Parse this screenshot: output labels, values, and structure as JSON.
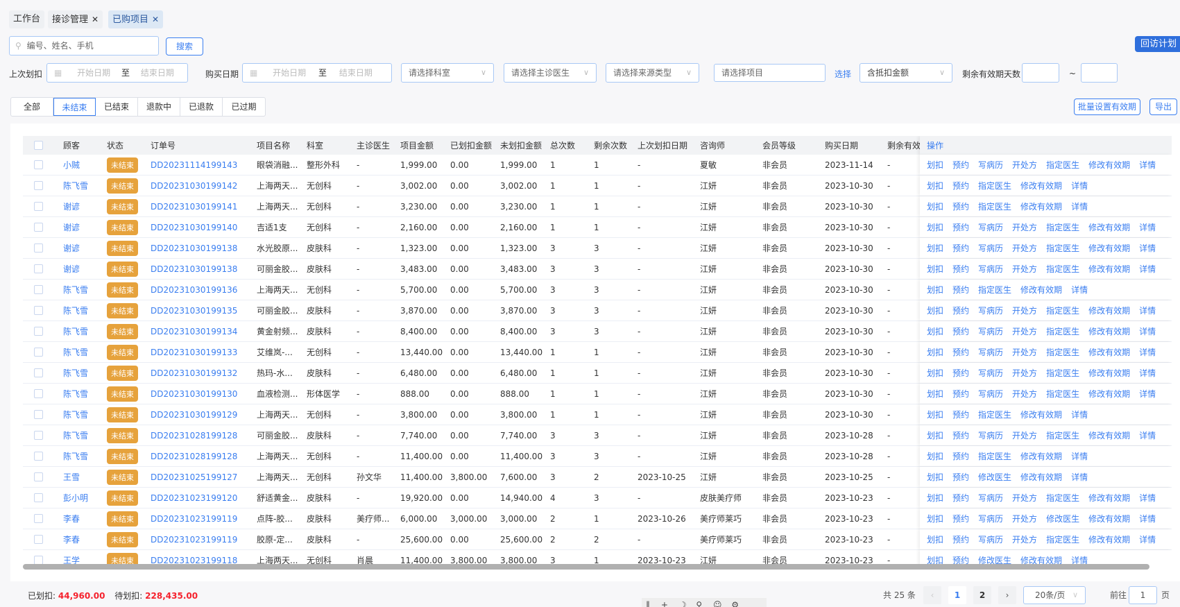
{
  "tabs": [
    {
      "label": "工作台"
    },
    {
      "label": "接诊管理",
      "close": "✕"
    },
    {
      "label": "已购项目",
      "close": "✕"
    }
  ],
  "search": {
    "placeholder": "编号、姓名、手机",
    "button": "搜索"
  },
  "followup_button": "回访计划",
  "filters": {
    "last_deduct_label": "上次划扣",
    "start_placeholder": "开始日期",
    "to": "至",
    "end_placeholder": "结束日期",
    "purchase_label": "购买日期",
    "department_placeholder": "请选择科室",
    "doctor_placeholder": "请选择主诊医生",
    "source_placeholder": "请选择来源类型",
    "item_placeholder": "请选择项目",
    "select_link": "选择",
    "amount_select": "含抵扣金额",
    "days_label": "剩余有效期天数",
    "tilde": "~"
  },
  "status_tabs": [
    "全部",
    "未结束",
    "已结束",
    "退款中",
    "已退款",
    "已过期"
  ],
  "active_status": 1,
  "batch_button": "批量设置有效期",
  "export_button": "导出",
  "columns": [
    "",
    "顾客",
    "状态",
    "订单号",
    "项目名称",
    "科室",
    "主诊医生",
    "项目金额",
    "已划扣金额",
    "未划扣金额",
    "总次数",
    "剩余次数",
    "上次划扣日期",
    "咨询师",
    "会员等级",
    "购买日期",
    "剩余有效期",
    "操作"
  ],
  "ops": {
    "A": [
      "划扣",
      "预约",
      "写病历",
      "开处方",
      "指定医生",
      "修改有效期",
      "详情"
    ],
    "B": [
      "划扣",
      "预约",
      "指定医生",
      "修改有效期",
      "详情"
    ],
    "C": [
      "划扣",
      "预约",
      "修改医生",
      "修改有效期",
      "详情"
    ],
    "D": [
      "划扣",
      "预约",
      "写病历",
      "开处方",
      "修改医生",
      "修改有效期",
      "详情"
    ]
  },
  "rows": [
    {
      "customer": "小贼",
      "status": "未结束",
      "order": "DD20231114199143",
      "item": "眼袋消融...",
      "dept": "整形外科",
      "doctor": "-",
      "amount": "1,999.00",
      "deducted": "0.00",
      "remaining_amt": "1,999.00",
      "total": "1",
      "left": "1",
      "last": "-",
      "consultant": "夏敏",
      "level": "非会员",
      "date": "2023-11-14",
      "valid": "-",
      "ops": "A"
    },
    {
      "customer": "陈飞雪",
      "status": "未结束",
      "order": "DD20231030199142",
      "item": "上海两天...",
      "dept": "无创科",
      "doctor": "-",
      "amount": "3,002.00",
      "deducted": "0.00",
      "remaining_amt": "3,002.00",
      "total": "1",
      "left": "1",
      "last": "-",
      "consultant": "江妍",
      "level": "非会员",
      "date": "2023-10-30",
      "valid": "-",
      "ops": "B"
    },
    {
      "customer": "谢谚",
      "status": "未结束",
      "order": "DD20231030199141",
      "item": "上海两天...",
      "dept": "无创科",
      "doctor": "-",
      "amount": "3,230.00",
      "deducted": "0.00",
      "remaining_amt": "3,230.00",
      "total": "1",
      "left": "1",
      "last": "-",
      "consultant": "江妍",
      "level": "非会员",
      "date": "2023-10-30",
      "valid": "-",
      "ops": "B"
    },
    {
      "customer": "谢谚",
      "status": "未结束",
      "order": "DD20231030199140",
      "item": "吉适1支",
      "dept": "无创科",
      "doctor": "-",
      "amount": "2,160.00",
      "deducted": "0.00",
      "remaining_amt": "2,160.00",
      "total": "1",
      "left": "1",
      "last": "-",
      "consultant": "江妍",
      "level": "非会员",
      "date": "2023-10-30",
      "valid": "-",
      "ops": "A"
    },
    {
      "customer": "谢谚",
      "status": "未结束",
      "order": "DD20231030199138",
      "item": "水光胶原...",
      "dept": "皮肤科",
      "doctor": "-",
      "amount": "1,323.00",
      "deducted": "0.00",
      "remaining_amt": "1,323.00",
      "total": "3",
      "left": "3",
      "last": "-",
      "consultant": "江妍",
      "level": "非会员",
      "date": "2023-10-30",
      "valid": "-",
      "ops": "A"
    },
    {
      "customer": "谢谚",
      "status": "未结束",
      "order": "DD20231030199138",
      "item": "可丽金胶...",
      "dept": "皮肤科",
      "doctor": "-",
      "amount": "3,483.00",
      "deducted": "0.00",
      "remaining_amt": "3,483.00",
      "total": "3",
      "left": "3",
      "last": "-",
      "consultant": "江妍",
      "level": "非会员",
      "date": "2023-10-30",
      "valid": "-",
      "ops": "A"
    },
    {
      "customer": "陈飞雪",
      "status": "未结束",
      "order": "DD20231030199136",
      "item": "上海两天...",
      "dept": "无创科",
      "doctor": "-",
      "amount": "5,700.00",
      "deducted": "0.00",
      "remaining_amt": "5,700.00",
      "total": "3",
      "left": "3",
      "last": "-",
      "consultant": "江妍",
      "level": "非会员",
      "date": "2023-10-30",
      "valid": "-",
      "ops": "B"
    },
    {
      "customer": "陈飞雪",
      "status": "未结束",
      "order": "DD20231030199135",
      "item": "可丽金胶...",
      "dept": "皮肤科",
      "doctor": "-",
      "amount": "3,870.00",
      "deducted": "0.00",
      "remaining_amt": "3,870.00",
      "total": "3",
      "left": "3",
      "last": "-",
      "consultant": "江妍",
      "level": "非会员",
      "date": "2023-10-30",
      "valid": "-",
      "ops": "A"
    },
    {
      "customer": "陈飞雪",
      "status": "未结束",
      "order": "DD20231030199134",
      "item": "黄金射频...",
      "dept": "皮肤科",
      "doctor": "-",
      "amount": "8,400.00",
      "deducted": "0.00",
      "remaining_amt": "8,400.00",
      "total": "3",
      "left": "3",
      "last": "-",
      "consultant": "江妍",
      "level": "非会员",
      "date": "2023-10-30",
      "valid": "-",
      "ops": "A"
    },
    {
      "customer": "陈飞雪",
      "status": "未结束",
      "order": "DD20231030199133",
      "item": "艾维岚-...",
      "dept": "无创科",
      "doctor": "-",
      "amount": "13,440.00",
      "deducted": "0.00",
      "remaining_amt": "13,440.00",
      "total": "1",
      "left": "1",
      "last": "-",
      "consultant": "江妍",
      "level": "非会员",
      "date": "2023-10-30",
      "valid": "-",
      "ops": "A"
    },
    {
      "customer": "陈飞雪",
      "status": "未结束",
      "order": "DD20231030199132",
      "item": "热玛-水...",
      "dept": "皮肤科",
      "doctor": "-",
      "amount": "6,480.00",
      "deducted": "0.00",
      "remaining_amt": "6,480.00",
      "total": "1",
      "left": "1",
      "last": "-",
      "consultant": "江妍",
      "level": "非会员",
      "date": "2023-10-30",
      "valid": "-",
      "ops": "A"
    },
    {
      "customer": "陈飞雪",
      "status": "未结束",
      "order": "DD20231030199130",
      "item": "血液检测...",
      "dept": "形体医学",
      "doctor": "-",
      "amount": "888.00",
      "deducted": "0.00",
      "remaining_amt": "888.00",
      "total": "1",
      "left": "1",
      "last": "-",
      "consultant": "江妍",
      "level": "非会员",
      "date": "2023-10-30",
      "valid": "-",
      "ops": "A"
    },
    {
      "customer": "陈飞雪",
      "status": "未结束",
      "order": "DD20231030199129",
      "item": "上海两天...",
      "dept": "无创科",
      "doctor": "-",
      "amount": "3,800.00",
      "deducted": "0.00",
      "remaining_amt": "3,800.00",
      "total": "1",
      "left": "1",
      "last": "-",
      "consultant": "江妍",
      "level": "非会员",
      "date": "2023-10-30",
      "valid": "-",
      "ops": "B"
    },
    {
      "customer": "陈飞雪",
      "status": "未结束",
      "order": "DD20231028199128",
      "item": "可丽金胶...",
      "dept": "皮肤科",
      "doctor": "-",
      "amount": "7,740.00",
      "deducted": "0.00",
      "remaining_amt": "7,740.00",
      "total": "3",
      "left": "3",
      "last": "-",
      "consultant": "江妍",
      "level": "非会员",
      "date": "2023-10-28",
      "valid": "-",
      "ops": "A"
    },
    {
      "customer": "陈飞雪",
      "status": "未结束",
      "order": "DD20231028199128",
      "item": "上海两天...",
      "dept": "无创科",
      "doctor": "-",
      "amount": "11,400.00",
      "deducted": "0.00",
      "remaining_amt": "11,400.00",
      "total": "3",
      "left": "3",
      "last": "-",
      "consultant": "江妍",
      "level": "非会员",
      "date": "2023-10-28",
      "valid": "-",
      "ops": "B"
    },
    {
      "customer": "王雪",
      "status": "未结束",
      "order": "DD20231025199127",
      "item": "上海两天...",
      "dept": "无创科",
      "doctor": "孙文华",
      "amount": "11,400.00",
      "deducted": "3,800.00",
      "remaining_amt": "7,600.00",
      "total": "3",
      "left": "2",
      "last": "2023-10-25",
      "consultant": "江妍",
      "level": "非会员",
      "date": "2023-10-25",
      "valid": "-",
      "ops": "C"
    },
    {
      "customer": "彭小明",
      "status": "未结束",
      "order": "DD20231023199120",
      "item": "舒适黄金...",
      "dept": "皮肤科",
      "doctor": "-",
      "amount": "19,920.00",
      "deducted": "0.00",
      "remaining_amt": "14,940.00",
      "total": "4",
      "left": "3",
      "last": "-",
      "consultant": "皮肤美疗师",
      "level": "非会员",
      "date": "2023-10-23",
      "valid": "-",
      "ops": "A"
    },
    {
      "customer": "李春",
      "status": "未结束",
      "order": "DD20231023199119",
      "item": "点阵-胶...",
      "dept": "皮肤科",
      "doctor": "美疗师...",
      "amount": "6,000.00",
      "deducted": "3,000.00",
      "remaining_amt": "3,000.00",
      "total": "2",
      "left": "1",
      "last": "2023-10-26",
      "consultant": "美疗师莱巧",
      "level": "非会员",
      "date": "2023-10-23",
      "valid": "-",
      "ops": "D"
    },
    {
      "customer": "李春",
      "status": "未结束",
      "order": "DD20231023199119",
      "item": "胶原-定...",
      "dept": "皮肤科",
      "doctor": "-",
      "amount": "25,600.00",
      "deducted": "0.00",
      "remaining_amt": "25,600.00",
      "total": "2",
      "left": "2",
      "last": "-",
      "consultant": "美疗师莱巧",
      "level": "非会员",
      "date": "2023-10-23",
      "valid": "-",
      "ops": "A"
    },
    {
      "customer": "王学",
      "status": "未结束",
      "order": "DD20231023199118",
      "item": "上海两天...",
      "dept": "无创科",
      "doctor": "肖晨",
      "amount": "11,400.00",
      "deducted": "3,800.00",
      "remaining_amt": "3,800.00",
      "total": "3",
      "left": "1",
      "last": "2023-10-23",
      "consultant": "江妍",
      "level": "非会员",
      "date": "2023-10-23",
      "valid": "-",
      "ops": "C"
    }
  ],
  "footer": {
    "deducted_label": "已划扣:",
    "deducted": "44,960.00",
    "pending_label": "待划扣:",
    "pending": "228,435.00"
  },
  "pagination": {
    "total": "共 25 条",
    "prev": "‹",
    "pages": [
      "1",
      "2"
    ],
    "current": "1",
    "next": "›",
    "page_size": "20条/页",
    "goto_label": "前往",
    "goto_value": "1",
    "page_unit": "页"
  },
  "colors": {
    "accent": "#3a7ef0",
    "badge": "#e6a23c",
    "amount_red": "#f5222d"
  }
}
